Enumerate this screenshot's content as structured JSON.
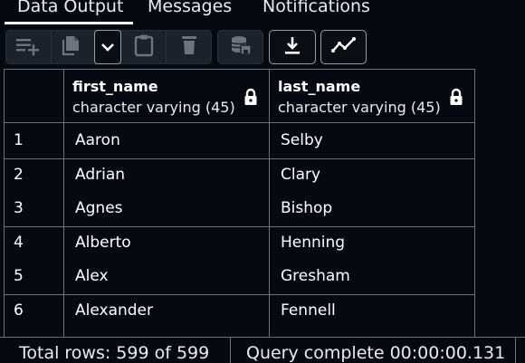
{
  "tabs": [
    {
      "label": "Data Output"
    },
    {
      "label": "Messages"
    },
    {
      "label": "Notifications"
    }
  ],
  "toolbar": {
    "buttons": [
      {
        "icon": "add-row-icon",
        "enabled": false
      },
      {
        "icon": "copy-icon",
        "enabled": false
      },
      {
        "icon": "chevron-down-icon",
        "enabled": true
      },
      {
        "icon": "paste-icon",
        "enabled": false
      },
      {
        "icon": "delete-icon",
        "enabled": false
      },
      {
        "icon": "save-data-icon",
        "enabled": false
      },
      {
        "icon": "download-icon",
        "enabled": true
      },
      {
        "icon": "graph-visualiser-icon",
        "enabled": true
      }
    ]
  },
  "grid": {
    "columns": [
      {
        "name": "first_name",
        "type": "character varying (45)"
      },
      {
        "name": "last_name",
        "type": "character varying (45)"
      }
    ],
    "rows": [
      {
        "n": "1",
        "first_name": "Aaron",
        "last_name": "Selby"
      },
      {
        "n": "2",
        "first_name": "Adrian",
        "last_name": "Clary"
      },
      {
        "n": "3",
        "first_name": "Agnes",
        "last_name": "Bishop"
      },
      {
        "n": "4",
        "first_name": "Alberto",
        "last_name": "Henning"
      },
      {
        "n": "5",
        "first_name": "Alex",
        "last_name": "Gresham"
      },
      {
        "n": "6",
        "first_name": "Alexander",
        "last_name": "Fennell"
      }
    ]
  },
  "status": {
    "total_rows": "Total rows: 599 of 599",
    "query": "Query complete 00:00:00.131"
  },
  "colors": {
    "background": "#050a12",
    "border": "#6b7079",
    "text": "#ffffff"
  }
}
